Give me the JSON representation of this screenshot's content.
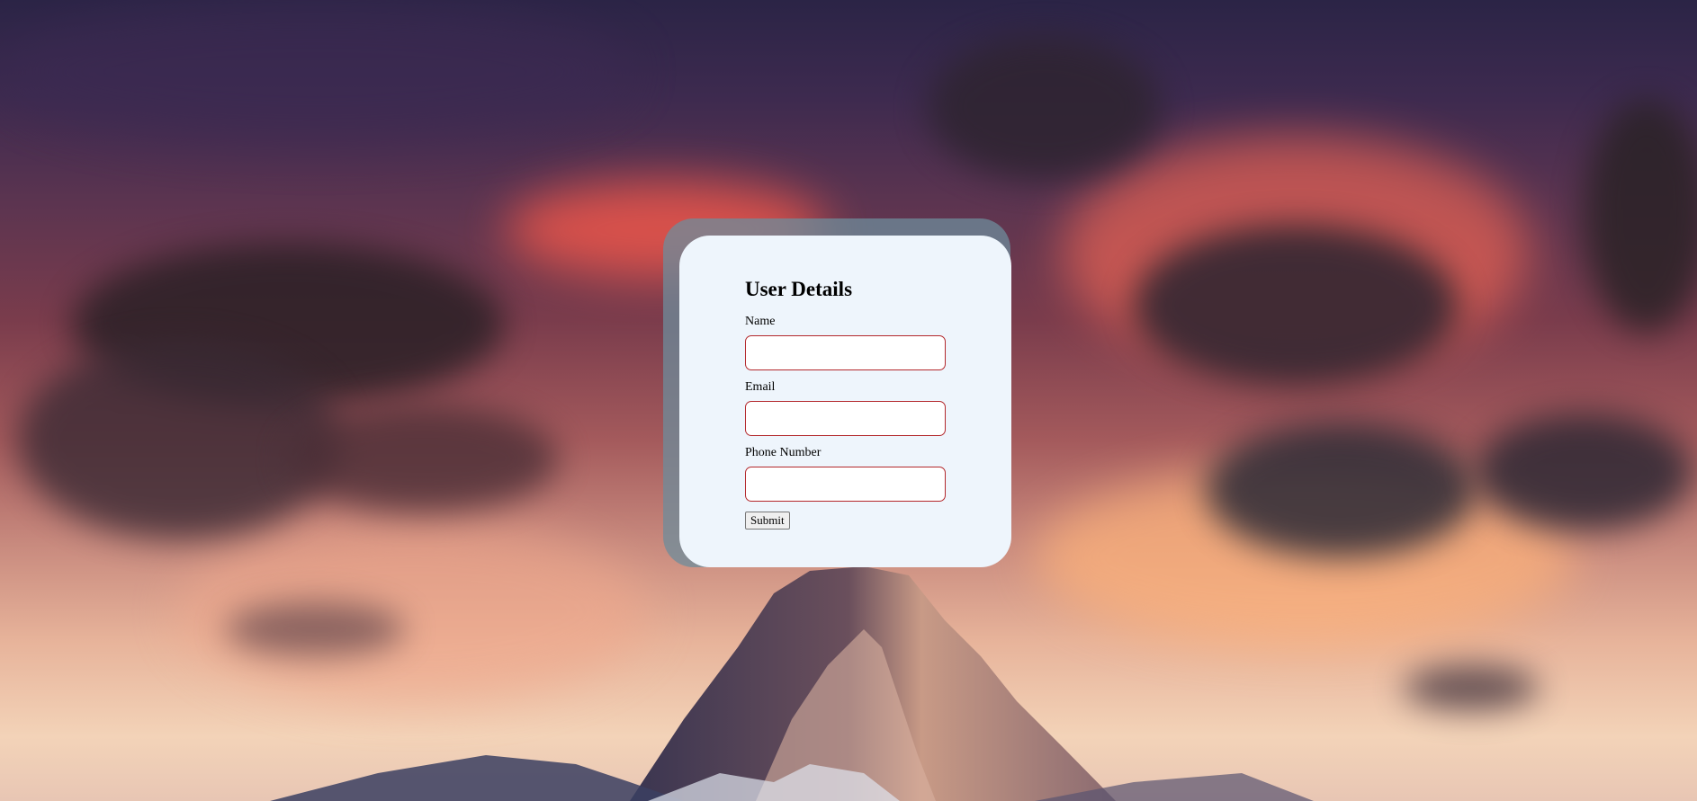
{
  "form": {
    "title": "User Details",
    "fields": [
      {
        "label": "Name",
        "value": "",
        "placeholder": ""
      },
      {
        "label": "Email",
        "value": "",
        "placeholder": ""
      },
      {
        "label": "Phone Number",
        "value": "",
        "placeholder": ""
      }
    ],
    "submit_label": "Submit"
  },
  "colors": {
    "card_background": "#eef5fc",
    "input_border": "#b3282c",
    "card_shadow": "#6e8c9b"
  },
  "background": {
    "subject": "sunset-mountain-photo"
  }
}
